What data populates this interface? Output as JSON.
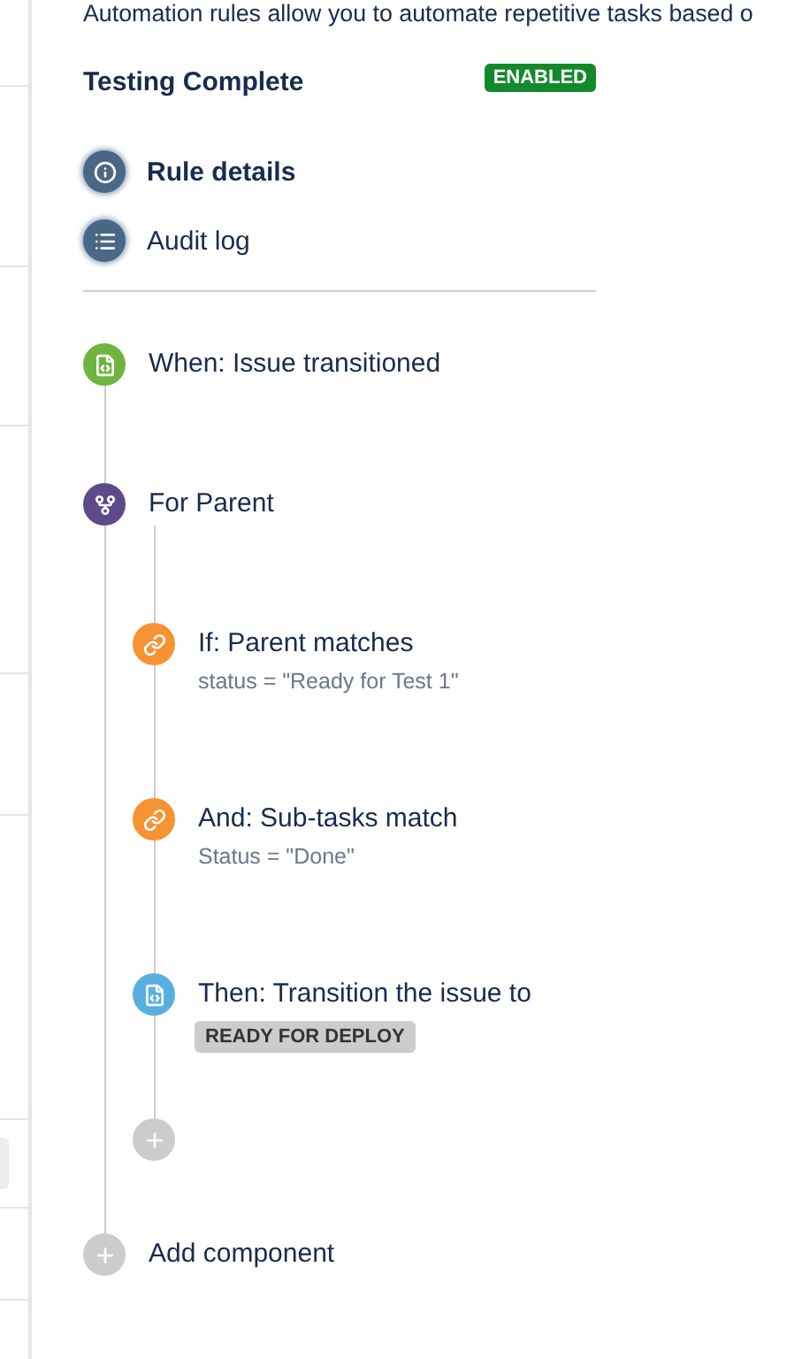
{
  "description": "Automation rules allow you to automate repetitive tasks based o",
  "rule": {
    "name": "Testing Complete",
    "status": "ENABLED"
  },
  "menu": [
    {
      "kind": "details",
      "label": "Rule details",
      "selected": true
    },
    {
      "kind": "audit",
      "label": "Audit log",
      "selected": false
    }
  ],
  "components": [
    {
      "kind": "trigger",
      "title": "When: Issue transitioned"
    },
    {
      "kind": "branch",
      "title": "For Parent",
      "children": [
        {
          "kind": "condition",
          "title": "If: Parent matches",
          "detail": "status = \"Ready for Test 1\""
        },
        {
          "kind": "condition",
          "title": "And: Sub-tasks match",
          "detail": "Status = \"Done\""
        },
        {
          "kind": "action",
          "title": "Then: Transition the issue to",
          "lozenge": "READY FOR DEPLOY"
        },
        {
          "kind": "add"
        }
      ]
    },
    {
      "kind": "add",
      "title": "Add component"
    }
  ]
}
